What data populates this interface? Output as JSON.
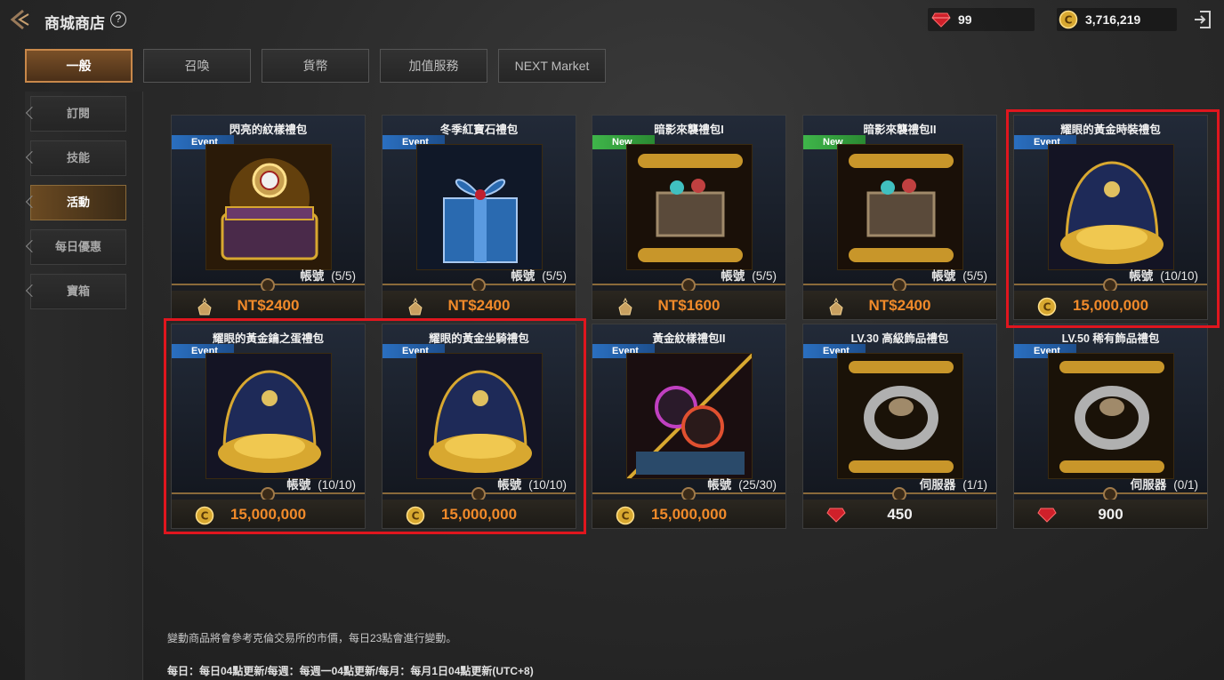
{
  "header": {
    "title": "商城商店",
    "help": "?",
    "gems": "99",
    "gold": "3,716,219"
  },
  "tabs": [
    {
      "label": "一般",
      "active": true
    },
    {
      "label": "召喚",
      "active": false
    },
    {
      "label": "貨幣",
      "active": false
    },
    {
      "label": "加值服務",
      "active": false
    },
    {
      "label": "NEXT Market",
      "active": false
    }
  ],
  "sidebar": [
    {
      "label": "訂閱",
      "active": false
    },
    {
      "label": "技能",
      "active": false
    },
    {
      "label": "活動",
      "active": true
    },
    {
      "label": "每日優惠",
      "active": false
    },
    {
      "label": "寶箱",
      "active": false
    }
  ],
  "cards": [
    {
      "name": "閃亮的紋樣禮包",
      "tag": "Event",
      "scope": "帳號",
      "limit": "(5/5)",
      "price": "NT$2400",
      "currency": "nt",
      "art": "chest-gold",
      "highlight": false
    },
    {
      "name": "冬季紅寶石禮包",
      "tag": "Event",
      "scope": "帳號",
      "limit": "(5/5)",
      "price": "NT$2400",
      "currency": "nt",
      "art": "gift-blue",
      "highlight": false
    },
    {
      "name": "暗影來襲禮包I",
      "tag": "New",
      "scope": "帳號",
      "limit": "(5/5)",
      "price": "NT$1600",
      "currency": "nt",
      "art": "scroll-chest",
      "highlight": false
    },
    {
      "name": "暗影來襲禮包II",
      "tag": "New",
      "scope": "帳號",
      "limit": "(5/5)",
      "price": "NT$2400",
      "currency": "nt",
      "art": "scroll-chest",
      "highlight": false
    },
    {
      "name": "耀眼的黃金時裝禮包",
      "tag": "Event",
      "scope": "帳號",
      "limit": "(10/10)",
      "price": "15,000,000",
      "currency": "gold",
      "art": "gold-pile",
      "highlight": true
    },
    {
      "name": "耀眼的黃金鑰之蛋禮包",
      "tag": "Event",
      "scope": "帳號",
      "limit": "(10/10)",
      "price": "15,000,000",
      "currency": "gold",
      "art": "gold-pile",
      "highlight": true
    },
    {
      "name": "耀眼的黃金坐騎禮包",
      "tag": "Event",
      "scope": "帳號",
      "limit": "(10/10)",
      "price": "15,000,000",
      "currency": "gold",
      "art": "gold-pile",
      "highlight": true
    },
    {
      "name": "黃金紋樣禮包II",
      "tag": "Event",
      "scope": "帳號",
      "limit": "(25/30)",
      "price": "15,000,000",
      "currency": "gold",
      "art": "orbs",
      "highlight": false
    },
    {
      "name": "LV.30 高級飾品禮包",
      "tag": "Event",
      "scope": "伺服器",
      "limit": "(1/1)",
      "price": "450",
      "currency": "gem",
      "art": "ring-scroll",
      "highlight": false
    },
    {
      "name": "LV.50 稀有飾品禮包",
      "tag": "Event",
      "scope": "伺服器",
      "limit": "(0/1)",
      "price": "900",
      "currency": "gem",
      "art": "ring-scroll",
      "highlight": false
    }
  ],
  "footer": {
    "note": "變動商品將會參考克倫交易所的市價，每日23點會進行變動。",
    "reset": "每日：每日04點更新/每週：每週一04點更新/每月：每月1日04點更新(UTC+8)"
  },
  "colors": {
    "accent": "#c8884a",
    "price_orange": "#f08a2a",
    "highlight_red": "#e0161e",
    "event_blue": "#2a6fc0",
    "new_green": "#3fb54a"
  }
}
